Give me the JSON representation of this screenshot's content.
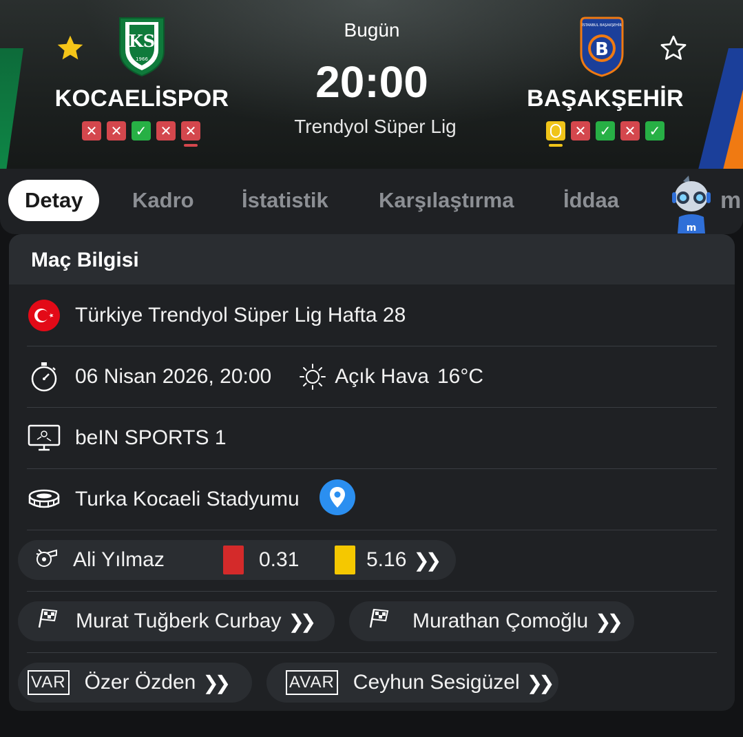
{
  "match": {
    "day_label": "Bugün",
    "time": "20:00",
    "league": "Trendyol Süper Lig"
  },
  "home": {
    "name": "KOCAELİSPOR",
    "logo_text": "KS",
    "logo_year": "1966",
    "favorite": true,
    "form": [
      "L",
      "L",
      "W",
      "L",
      "L"
    ]
  },
  "away": {
    "name": "BAŞAKŞEHİR",
    "logo_text": "B",
    "favorite": false,
    "form": [
      "D",
      "L",
      "W",
      "L",
      "W"
    ]
  },
  "tabs": [
    {
      "label": "Detay",
      "active": true
    },
    {
      "label": "Kadro"
    },
    {
      "label": "İstatistik"
    },
    {
      "label": "Karşılaştırma"
    },
    {
      "label": "İddaa"
    }
  ],
  "mascot_label": "m",
  "info": {
    "title": "Maç Bilgisi",
    "competition": "Türkiye Trendyol Süper Lig Hafta 28",
    "datetime": "06 Nisan 2026, 20:00",
    "weather": "Açık Hava",
    "temperature": "16°C",
    "broadcaster": "beIN SPORTS 1",
    "stadium": "Turka Kocaeli Stadyumu",
    "referee": {
      "name": "Ali Yılmaz",
      "red_avg": "0.31",
      "yellow_avg": "5.16"
    },
    "assistants": [
      "Murat Tuğberk Curbay",
      "Murathan Çomoğlu"
    ],
    "var": {
      "label": "VAR",
      "name": "Özer Özden"
    },
    "avar": {
      "label": "AVAR",
      "name": "Ceyhun Sesigüzel"
    }
  },
  "colors": {
    "loss": "#d4474d",
    "win": "#27b045",
    "draw": "#f0c419",
    "red_card": "#d42a2a",
    "yellow_card": "#f5c800",
    "map_pin": "#2b8ff0"
  }
}
